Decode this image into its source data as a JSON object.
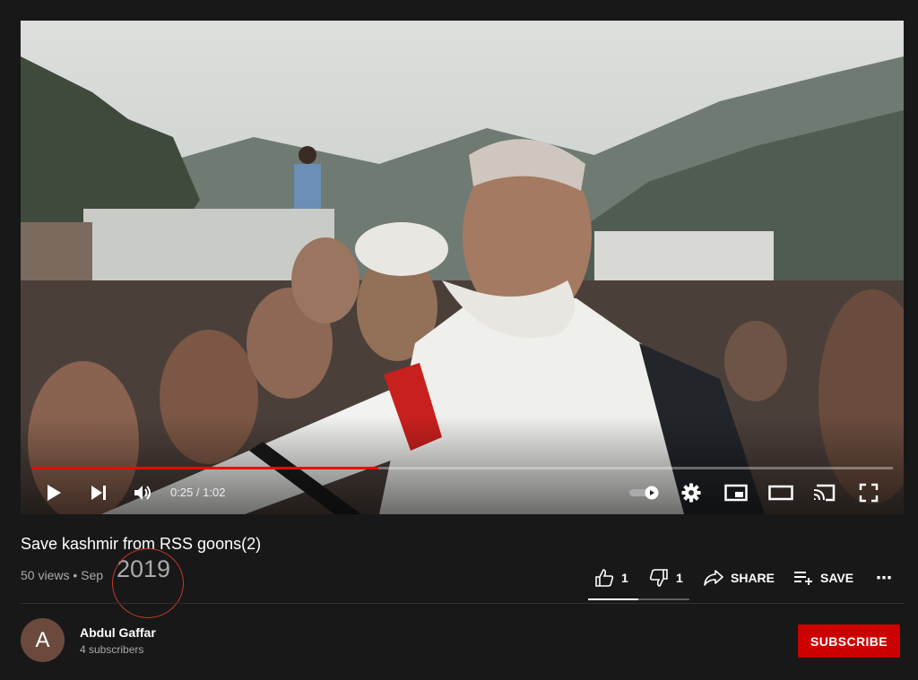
{
  "player": {
    "current_time": "0:25",
    "duration": "1:02",
    "time_display": "0:25 / 1:02",
    "progress_fraction": 0.403,
    "accent_color": "#ff0000",
    "icons": [
      "play-icon",
      "next-icon",
      "volume-icon",
      "autoplay-toggle-icon",
      "settings-icon",
      "miniplayer-icon",
      "theater-mode-icon",
      "cast-icon",
      "fullscreen-icon"
    ]
  },
  "video": {
    "title": "Save kashmir from RSS goons(2)",
    "views": "50 views",
    "date_prefix": "Sep",
    "meta_text": "50 views • Sep",
    "year_annotation": "2019"
  },
  "actions": {
    "like_count": "1",
    "dislike_count": "1",
    "share_label": "SHARE",
    "save_label": "SAVE",
    "more_label": "⋯"
  },
  "channel": {
    "avatar_letter": "A",
    "name": "Abdul Gaffar",
    "subscribers": "4 subscribers",
    "subscribe_label": "SUBSCRIBE",
    "subscribe_color": "#cc0000"
  }
}
